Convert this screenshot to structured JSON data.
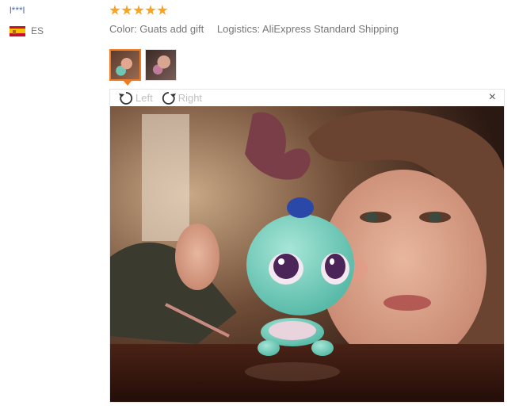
{
  "reviewer": {
    "name": "l***l",
    "country_code": "ES"
  },
  "review": {
    "rating": 5,
    "color_label": "Color: Guats add gift",
    "logistics_label": "Logistics: AliExpress Standard Shipping"
  },
  "viewer": {
    "rotate_left_label": "Left",
    "rotate_right_label": "Right",
    "close_symbol": "×"
  },
  "colors": {
    "star": "#f8a322",
    "accent": "#f47a20",
    "link": "#4b6da8"
  }
}
